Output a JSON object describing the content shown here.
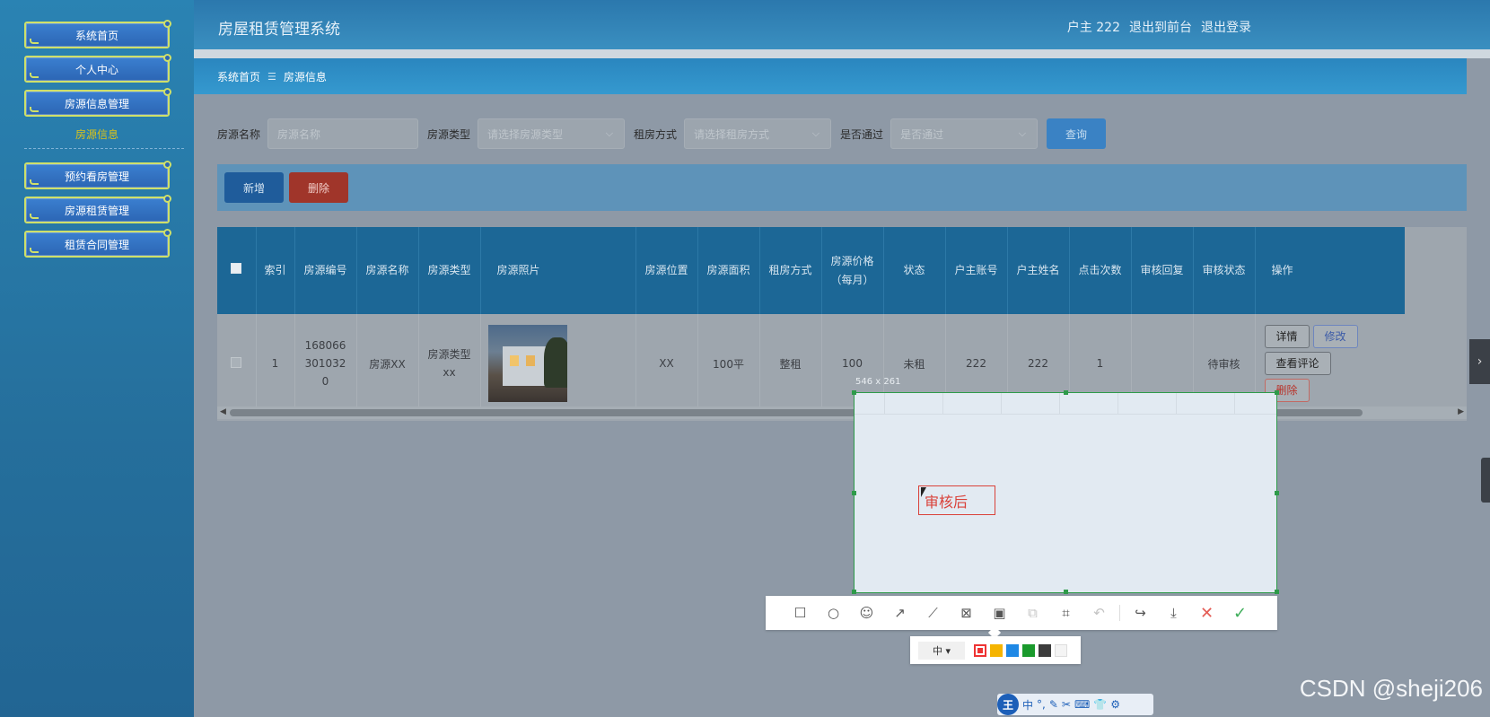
{
  "sidebar": {
    "items": [
      "系统首页",
      "个人中心",
      "房源信息管理"
    ],
    "subitem": "房源信息",
    "items2": [
      "预约看房管理",
      "房源租赁管理",
      "租赁合同管理"
    ]
  },
  "header": {
    "title": "房屋租赁管理系统",
    "user": "户主 222",
    "front": "退出到前台",
    "logout": "退出登录"
  },
  "breadcrumb": {
    "home": "系统首页",
    "sep": "☰",
    "current": "房源信息"
  },
  "search": {
    "name_label": "房源名称",
    "name_placeholder": "房源名称",
    "type_label": "房源类型",
    "type_placeholder": "请选择房源类型",
    "mode_label": "租房方式",
    "mode_placeholder": "请选择租房方式",
    "pass_label": "是否通过",
    "pass_placeholder": "是否通过",
    "query": "查询"
  },
  "toolbar": {
    "add": "新增",
    "delete": "删除"
  },
  "table": {
    "headers": {
      "index": "索引",
      "code": "房源编号",
      "name": "房源名称",
      "type": "房源类型",
      "photo": "房源照片",
      "location": "房源位置",
      "area": "房源面积",
      "mode": "租房方式",
      "price": "房源价格（每月）",
      "status": "状态",
      "owner_acct": "户主账号",
      "owner_name": "户主姓名",
      "clicks": "点击次数",
      "reply": "审核回复",
      "audit": "审核状态",
      "ops": "操作"
    },
    "rows": [
      {
        "index": "1",
        "code": "1680663010320",
        "name": "房源XX",
        "type": "房源类型xx",
        "location": "XX",
        "area": "100平",
        "mode": "整租",
        "price": "100",
        "status": "未租",
        "owner_acct": "222",
        "owner_name": "222",
        "clicks": "1",
        "reply": "",
        "audit": "待审核"
      }
    ],
    "ops": {
      "detail": "详情",
      "edit": "修改",
      "comments": "查看评论",
      "delete": "删除"
    }
  },
  "overlay": {
    "size": "546 x 261",
    "note": "审核后",
    "font_size": "中 ▾",
    "colors": [
      "#e02f2f",
      "#f5b400",
      "#1e88e5",
      "#1a9a2c",
      "#3c3c3c",
      "#f4f4f4"
    ]
  },
  "ime": {
    "logo": "王",
    "mode": "中"
  },
  "watermark": "CSDN @sheji206"
}
